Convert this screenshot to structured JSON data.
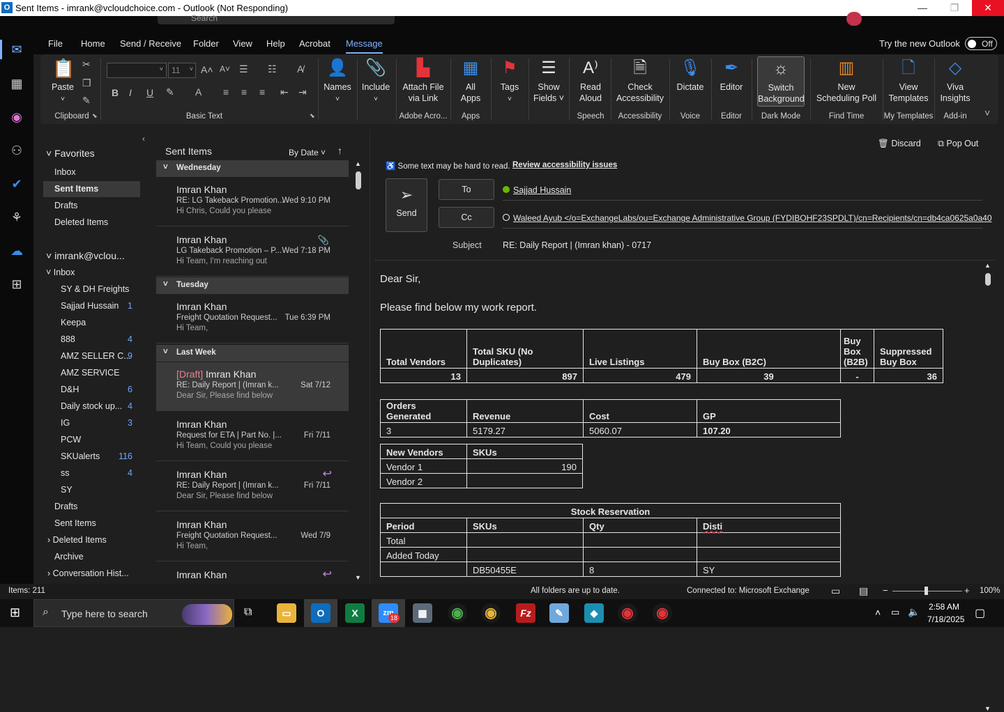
{
  "window": {
    "title": "Sent Items - imrank@vcloudchoice.com - Outlook (Not Responding)",
    "app_icon": "O",
    "minimize": "—",
    "maximize": "❐",
    "close": "✕",
    "search_placeholder": "Search"
  },
  "menu": {
    "items": [
      "File",
      "Home",
      "Send / Receive",
      "Folder",
      "View",
      "Help",
      "Acrobat",
      "Message"
    ],
    "try_new": "Try the new Outlook",
    "toggle_label": "Off"
  },
  "ribbon": {
    "paste": "Paste",
    "clipboard": "Clipboard",
    "font_size": "11",
    "basic_text": "Basic Text",
    "names": "Names",
    "include": "Include",
    "attach_file_1": "Attach File",
    "attach_file_2": "via Link",
    "adobe": "Adobe Acro...",
    "all_apps_1": "All",
    "all_apps_2": "Apps",
    "apps": "Apps",
    "tags": "Tags",
    "show_fields_1": "Show",
    "show_fields_2": "Fields ˅",
    "read_aloud_1": "Read",
    "read_aloud_2": "Aloud",
    "speech": "Speech",
    "check_acc_1": "Check",
    "check_acc_2": "Accessibility",
    "accessibility": "Accessibility",
    "dictate": "Dictate",
    "voice": "Voice",
    "editor": "Editor",
    "editor_group": "Editor",
    "switch_bg_1": "Switch",
    "switch_bg_2": "Background",
    "dark_mode": "Dark Mode",
    "new_poll_1": "New",
    "new_poll_2": "Scheduling Poll",
    "find_time": "Find Time",
    "view_templates_1": "View",
    "view_templates_2": "Templates",
    "my_templates": "My Templates",
    "viva_1": "Viva",
    "viva_2": "Insights",
    "addin": "Add-in"
  },
  "folders": {
    "favorites": "Favorites",
    "fav_items": [
      "Inbox",
      "Sent Items",
      "Drafts",
      "Deleted Items"
    ],
    "account": "imrank@vclou...",
    "inbox": "Inbox",
    "sub": [
      {
        "name": "SY & DH Freights",
        "count": ""
      },
      {
        "name": "Sajjad Hussain",
        "count": "1"
      },
      {
        "name": "Keepa",
        "count": ""
      },
      {
        "name": "888",
        "count": "4"
      },
      {
        "name": "AMZ SELLER C...",
        "count": "9"
      },
      {
        "name": "AMZ SERVICE",
        "count": ""
      },
      {
        "name": "D&H",
        "count": "6"
      },
      {
        "name": "Daily stock up...",
        "count": "4"
      },
      {
        "name": "IG",
        "count": "3"
      },
      {
        "name": "PCW",
        "count": ""
      },
      {
        "name": "SKUalerts",
        "count": "116"
      },
      {
        "name": "ss",
        "count": "4"
      },
      {
        "name": "SY",
        "count": ""
      }
    ],
    "after": [
      "Drafts",
      "Sent Items",
      "Deleted Items",
      "Archive",
      "Conversation Hist..."
    ]
  },
  "list": {
    "title": "Sent Items",
    "sort": "By Date",
    "groups": [
      "Wednesday",
      "Tuesday",
      "Last Week"
    ],
    "messages": [
      {
        "sender": "Imran Khan",
        "draft": "",
        "subject": "RE: LG Takeback Promotion...",
        "preview": "Hi Chris,  Could you please",
        "date": "Wed 9:10 PM"
      },
      {
        "sender": "Imran Khan",
        "draft": "",
        "subject": "LG Takeback Promotion – P...",
        "preview": "Hi Team,  I'm reaching out",
        "date": "Wed 7:18 PM"
      },
      {
        "sender": "Imran Khan",
        "draft": "",
        "subject": "Freight Quotation Request...",
        "preview": "Hi Team,",
        "date": "Tue 6:39 PM"
      },
      {
        "sender": "Imran Khan",
        "draft": "[Draft] ",
        "subject": "RE:  Daily Report | (Imran k...",
        "preview": "Dear Sir,  Please find below",
        "date": "Sat 7/12"
      },
      {
        "sender": "Imran Khan",
        "draft": "",
        "subject": "Request for ETA | Part No. |...",
        "preview": "Hi Team,  Could you please",
        "date": "Fri 7/11"
      },
      {
        "sender": "Imran Khan",
        "draft": "",
        "subject": "RE:  Daily Report | (Imran k...",
        "preview": "Dear Sir,  Please find below",
        "date": "Fri 7/11"
      },
      {
        "sender": "Imran Khan",
        "draft": "",
        "subject": "Freight Quotation Request...",
        "preview": "Hi Team,",
        "date": "Wed 7/9"
      },
      {
        "sender": "Imran Khan",
        "draft": "",
        "subject": "",
        "preview": "",
        "date": ""
      }
    ]
  },
  "compose": {
    "discard": "Discard",
    "popout": "Pop Out",
    "acc_warning": "Some text may be hard to read.",
    "acc_link": "Review accessibility issues",
    "send": "Send",
    "to": "To",
    "cc": "Cc",
    "to_value": "Sajjad Hussain",
    "cc_value": "Waleed Ayub </o=ExchangeLabs/ou=Exchange Administrative Group (FYDIBOHF23SPDLT)/cn=Recipients/cn=db4ca0625a0a40",
    "subject_label": "Subject",
    "subject_value": "RE:  Daily Report | (Imran khan) - 0717",
    "greeting": "Dear Sir,",
    "intro": "Please find below my work report."
  },
  "table1": {
    "headers": [
      "Total Vendors",
      "Total SKU (No Duplicates)",
      "Live Listings",
      "Buy Box (B2C)",
      "Buy Box (B2B)",
      "Suppressed Buy Box"
    ],
    "values": [
      "13",
      "897",
      "479",
      "39",
      "-",
      "36"
    ]
  },
  "table2": {
    "headers": [
      "Orders Generated",
      "Revenue",
      "Cost",
      "GP"
    ],
    "values": [
      "3",
      "5179.27",
      "5060.07",
      "107.20"
    ]
  },
  "table3": {
    "headers": [
      "New Vendors",
      "SKUs"
    ],
    "rows": [
      [
        "Vendor 1",
        "190"
      ],
      [
        "Vendor 2",
        ""
      ]
    ]
  },
  "table4": {
    "title": "Stock Reservation",
    "headers": [
      "Period",
      "SKUs",
      "Qty",
      "Disti"
    ],
    "rows": [
      [
        "Total",
        "",
        "",
        ""
      ],
      [
        "Added Today",
        "",
        "",
        ""
      ],
      [
        "",
        "DB50455E",
        "8",
        "SY"
      ]
    ]
  },
  "status": {
    "items": "Items: 211",
    "sync": "All folders are up to date.",
    "connected": "Connected to: Microsoft Exchange",
    "zoom": "100%"
  },
  "taskbar": {
    "search_placeholder": "Type here to search",
    "time": "2:58 AM",
    "date": "7/18/2025",
    "zoom_badge": "18"
  },
  "colors": {
    "accent": "#7fb3ff",
    "draft": "#e8828b",
    "count": "#6fa8ff",
    "close": "#e81123"
  }
}
